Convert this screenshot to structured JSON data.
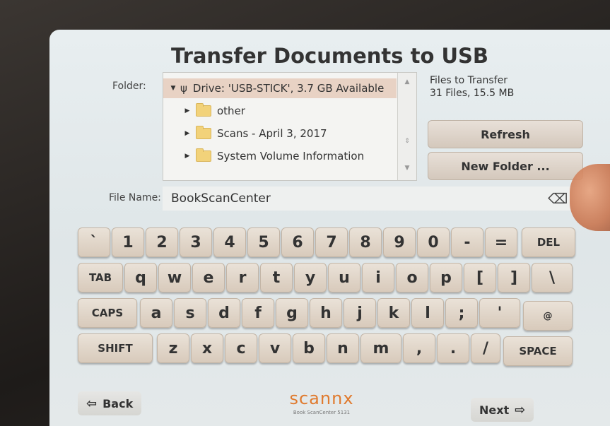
{
  "title": "Transfer Documents to USB",
  "folder": {
    "label": "Folder:",
    "drive": "Drive: 'USB-STICK', 3.7 GB Available",
    "items": [
      "other",
      "Scans - April 3, 2017",
      "System Volume Information"
    ]
  },
  "transfer": {
    "title": "Files to Transfer",
    "summary": "31 Files, 15.5 MB"
  },
  "buttons": {
    "refresh": "Refresh",
    "new_folder": "New Folder ...",
    "back": "Back",
    "next": "Next"
  },
  "file_name": {
    "label": "File Name:",
    "value": "BookScanCenter"
  },
  "keyboard": {
    "row1": [
      "`",
      "1",
      "2",
      "3",
      "4",
      "5",
      "6",
      "7",
      "8",
      "9",
      "0",
      "-",
      "=",
      "DEL"
    ],
    "row2": [
      "TAB",
      "q",
      "w",
      "e",
      "r",
      "t",
      "y",
      "u",
      "i",
      "o",
      "p",
      "[",
      "]",
      "\\"
    ],
    "row3": [
      "CAPS",
      "a",
      "s",
      "d",
      "f",
      "g",
      "h",
      "j",
      "k",
      "l",
      ";",
      "'",
      "@"
    ],
    "row4": [
      "SHIFT",
      "z",
      "x",
      "c",
      "v",
      "b",
      "n",
      "m",
      ",",
      ".",
      "/",
      "SPACE"
    ]
  },
  "branding": {
    "logo": "scannx",
    "model": "Book ScanCenter 5131"
  },
  "icons": {
    "usb": "usb-icon",
    "folder": "folder-icon",
    "backspace": "backspace-icon",
    "back_arrow": "left-arrow-icon",
    "next_arrow": "right-arrow-icon"
  },
  "colors": {
    "key": "#ddd0c2",
    "logo": "#e07a2e",
    "selected_row": "#e8d2c4"
  }
}
